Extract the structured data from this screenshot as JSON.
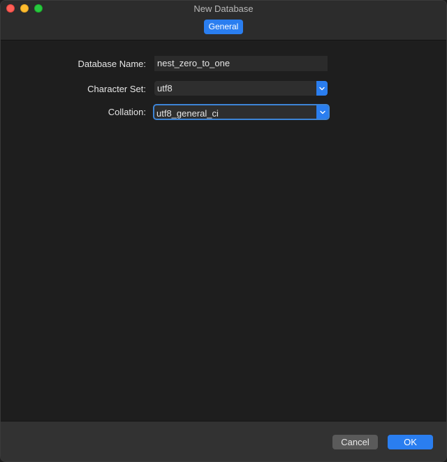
{
  "window": {
    "title": "New Database"
  },
  "tabs": [
    {
      "label": "General",
      "selected": true
    }
  ],
  "form": {
    "database_name": {
      "label": "Database Name:",
      "value": "nest_zero_to_one"
    },
    "character_set": {
      "label": "Character Set:",
      "value": "utf8"
    },
    "collation": {
      "label": "Collation:",
      "value": "utf8_general_ci",
      "focused": true
    }
  },
  "footer": {
    "cancel_label": "Cancel",
    "ok_label": "OK"
  },
  "colors": {
    "accent": "#2a7ef0",
    "background": "#1e1e1e",
    "titlebar": "#2c2c2c",
    "footer": "#323232",
    "close": "#fe5f57",
    "minimize": "#febc2e",
    "zoom": "#28c840"
  },
  "icons": {
    "select_arrow": "chevron-down-icon"
  }
}
